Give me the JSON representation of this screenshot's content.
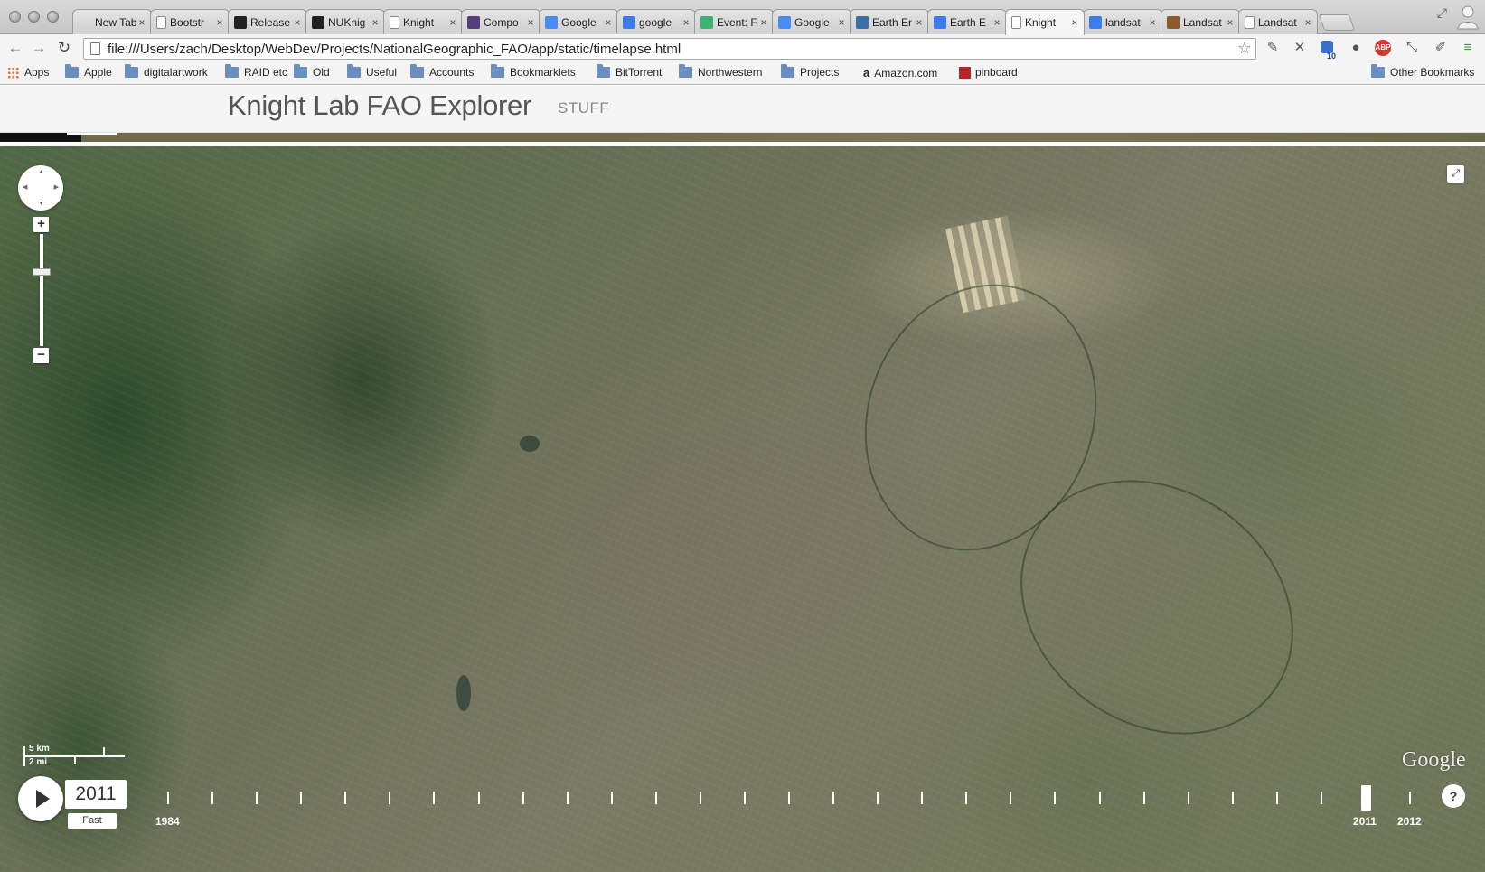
{
  "browser": {
    "tabs": [
      {
        "title": "New Tab",
        "icon": "none",
        "color": ""
      },
      {
        "title": "Bootstr",
        "icon": "page",
        "color": ""
      },
      {
        "title": "Release",
        "icon": "github",
        "color": "#222222"
      },
      {
        "title": "NUKnig",
        "icon": "github",
        "color": "#222222"
      },
      {
        "title": "Knight",
        "icon": "page",
        "color": ""
      },
      {
        "title": "Compo",
        "icon": "bootstrap",
        "color": "#563d7c"
      },
      {
        "title": "Google",
        "icon": "google-maps",
        "color": "#4a8af4"
      },
      {
        "title": "google",
        "icon": "google",
        "color": "#3b7bea"
      },
      {
        "title": "Event: F",
        "icon": "cloud",
        "color": "#3cb371"
      },
      {
        "title": "Google",
        "icon": "google-maps",
        "color": "#4a8af4"
      },
      {
        "title": "Earth Er",
        "icon": "blog",
        "color": "#3b6ea8"
      },
      {
        "title": "Earth E",
        "icon": "google",
        "color": "#3b7bea"
      },
      {
        "title": "Knight",
        "icon": "page",
        "color": "",
        "active": true
      },
      {
        "title": "landsat",
        "icon": "google",
        "color": "#3b7bea"
      },
      {
        "title": "Landsat",
        "icon": "landsat",
        "color": "#8b5a2b"
      },
      {
        "title": "Landsat",
        "icon": "page",
        "color": ""
      }
    ],
    "url": "file:///Users/zach/Desktop/WebDev/Projects/NationalGeographic_FAO/app/static/timelapse.html",
    "extension_badge": "10",
    "abp_label": "ABP",
    "bookmarks": [
      {
        "label": "Apps",
        "icon": "apps-grid-icon"
      },
      {
        "label": "Apple",
        "icon": "folder-icon"
      },
      {
        "label": "digitalartwork",
        "icon": "folder-icon"
      },
      {
        "label": "RAID etc",
        "icon": "folder-icon"
      },
      {
        "label": "Old",
        "icon": "folder-icon"
      },
      {
        "label": "Useful",
        "icon": "folder-icon"
      },
      {
        "label": "Accounts",
        "icon": "folder-icon"
      },
      {
        "label": "Bookmarklets",
        "icon": "folder-icon"
      },
      {
        "label": "BitTorrent",
        "icon": "folder-icon"
      },
      {
        "label": "Northwestern",
        "icon": "folder-icon"
      },
      {
        "label": "Projects",
        "icon": "folder-icon"
      },
      {
        "label": "Amazon.com",
        "icon": "amazon-icon"
      },
      {
        "label": "pinboard",
        "icon": "pinboard-icon"
      }
    ],
    "other_bookmarks": "Other Bookmarks"
  },
  "site": {
    "title": "Knight Lab FAO Explorer",
    "subtitle": "STUFF"
  },
  "map": {
    "scale_km": "5 km",
    "scale_mi": "2 mi",
    "attribution": "Google"
  },
  "timelapse": {
    "current_year": "2011",
    "speed_label": "Fast",
    "start_label": "1984",
    "end_label": "2012",
    "current_label": "2011",
    "help_label": "?",
    "years": [
      1984,
      1985,
      1986,
      1987,
      1988,
      1989,
      1990,
      1991,
      1992,
      1993,
      1994,
      1995,
      1996,
      1997,
      1998,
      1999,
      2000,
      2001,
      2002,
      2003,
      2004,
      2005,
      2006,
      2007,
      2008,
      2009,
      2010,
      2011,
      2012
    ],
    "current_index": 27
  }
}
